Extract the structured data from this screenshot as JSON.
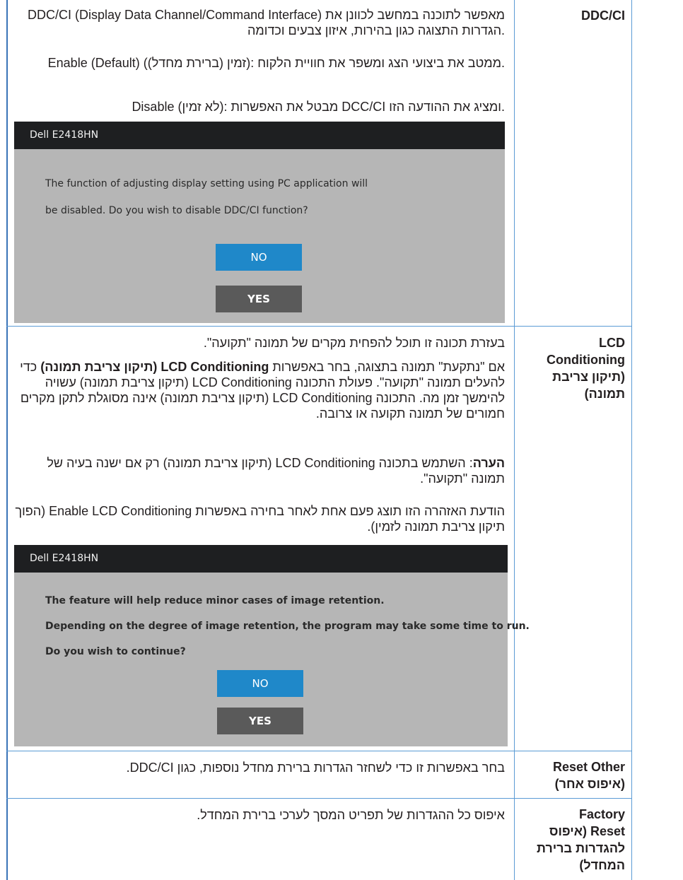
{
  "rows": {
    "ddcci": {
      "label": "DDC/CI",
      "p1": "DDC/CI (Display Data Channel/Command Interface) מאפשר לתוכנה במחשב לכוונן את הגדרות התצוגה כגון בהירות, איזון צבעים וכדומה.",
      "p2": "Enable (Default) (זמין (ברירת מחדל)): ממטב את ביצועי הצג ומשפר את חוויית הלקוח.",
      "p3": "Disable (לא זמין): מבטל את האפשרות DCC/CI ומציג את ההודעה הזו.",
      "dialog": {
        "title": "Dell E2418HN",
        "line1": "The function of adjusting display setting using PC application will",
        "line2": "be disabled. Do you wish to disable DDC/CI function?",
        "no_label": "NO",
        "yes_label": "YES"
      }
    },
    "lcd": {
      "label_line1": "LCD",
      "label_line2": "Conditioning",
      "label_line3": "(תיקון צריבת",
      "label_line4": "תמונה)",
      "p1": "בעזרת תכונה זו תוכל להפחית מקרים של תמונה \"תקועה\".",
      "p2_a": "אם \"נתקעת\" תמונה בתצוגה, בחר באפשרות ",
      "p2_b": "LCD Conditioning (תיקון צריבת תמונה)",
      "p2_c": " כדי להעלים תמונה \"תקועה\". פעולת התכונה LCD Conditioning (תיקון צריבת תמונה) עשויה להימשך זמן מה. התכונה LCD Conditioning (תיקון צריבת תמונה) אינה מסוגלת לתקן מקרים חמורים של תמונה תקועה או צרובה.",
      "p3_a": "הערה",
      "p3_b": ": השתמש בתכונה LCD Conditioning (תיקון צריבת תמונה) רק אם ישנה בעיה של תמונה \"תקועה\".",
      "p4": "הודעת האזהרה הזו תוצג פעם אחת לאחר בחירה באפשרות Enable LCD Conditioning (הפוך תיקון צריבת תמונה לזמין).",
      "dialog": {
        "title": "Dell E2418HN",
        "line1": "The feature will help reduce minor cases of image retention.",
        "line2": "Depending on the degree of image retention, the program may take some time to run.",
        "line3": "Do you wish to continue?",
        "no_label": "NO",
        "yes_label": "YES"
      }
    },
    "reset_other": {
      "label_line1": "Reset Other",
      "label_line2": "(איפוס אחר)",
      "text": "בחר באפשרות זו כדי לשחזר הגדרות ברירת מחדל נוספות, כגון DDC/CI."
    },
    "factory_reset": {
      "label_line1": "Factory",
      "label_line2": "Reset (איפוס",
      "label_line3": "להגדרות ברירת",
      "label_line4": "המחדל)",
      "text": "איפוס כל ההגדרות של תפריט המסך לערכי ברירת המחדל."
    }
  }
}
